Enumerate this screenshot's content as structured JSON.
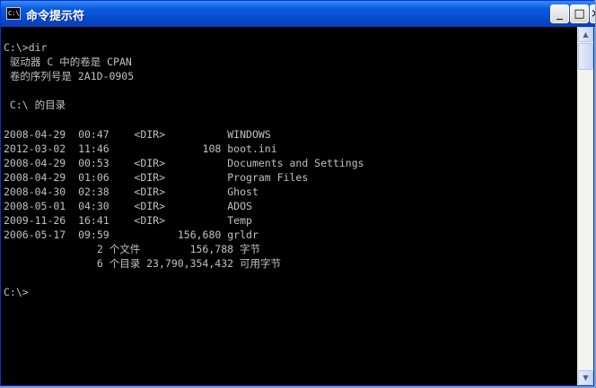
{
  "window": {
    "title": "命令提示符",
    "icon_text": "C:\\",
    "minimize_label": "_",
    "maximize_label": "□",
    "close_label": "×"
  },
  "console": {
    "lines": [
      "C:\\>dir",
      " 驱动器 C 中的卷是 CPAN",
      " 卷的序列号是 2A1D-0905",
      "",
      " C:\\ 的目录",
      "",
      "2008-04-29  00:47    <DIR>          WINDOWS",
      "2012-03-02  11:46               108 boot.ini",
      "2008-04-29  00:53    <DIR>          Documents and Settings",
      "2008-04-29  01:06    <DIR>          Program Files",
      "2008-04-30  02:38    <DIR>          Ghost",
      "2008-05-01  04:30    <DIR>          ADOS",
      "2009-11-26  16:41    <DIR>          Temp",
      "2006-05-17  09:59           156,680 grldr",
      "               2 个文件        156,788 字节",
      "               6 个目录 23,790,354,432 可用字节",
      "",
      "C:\\>"
    ]
  },
  "scrollbar": {
    "up_label": "▲",
    "down_label": "▼"
  }
}
